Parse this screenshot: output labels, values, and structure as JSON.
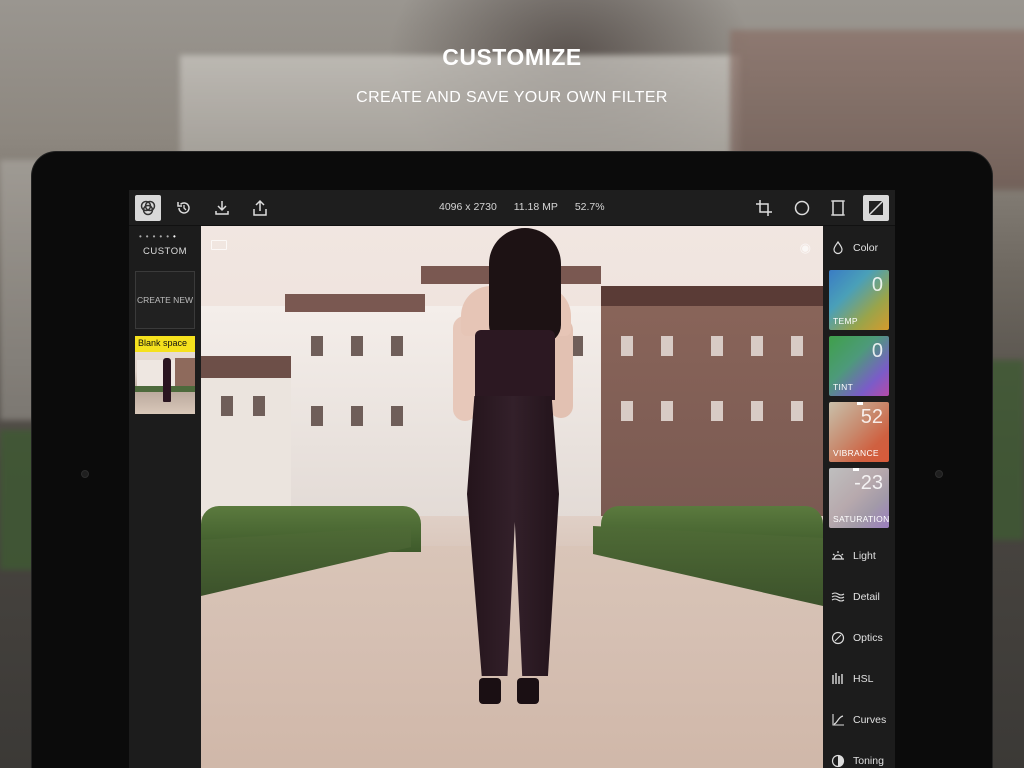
{
  "header": {
    "title": "CUSTOMIZE",
    "subtitle": "CREATE AND SAVE YOUR OWN FILTER"
  },
  "toolbar": {
    "left_icons": [
      "filters-icon",
      "history-icon",
      "download-icon",
      "share-icon"
    ],
    "info": {
      "dimensions": "4096 x 2730",
      "megapixels": "11.18 MP",
      "zoom": "52.7%"
    },
    "right_icons": [
      "crop-icon",
      "vignette-icon",
      "frame-icon",
      "adjust-icon"
    ]
  },
  "left_panel": {
    "label": "CUSTOM",
    "create_new": "CREATE NEW",
    "filters": [
      {
        "name": "Blank space"
      }
    ]
  },
  "right_panel": {
    "color_label": "Color",
    "tiles": [
      {
        "label": "TEMP",
        "value": "0"
      },
      {
        "label": "TINT",
        "value": "0"
      },
      {
        "label": "VIBRANCE",
        "value": "52"
      },
      {
        "label": "SATURATION",
        "value": "-23"
      }
    ],
    "sections": [
      {
        "label": "Light",
        "icon": "sun-icon"
      },
      {
        "label": "Detail",
        "icon": "detail-icon"
      },
      {
        "label": "Optics",
        "icon": "lens-icon"
      },
      {
        "label": "HSL",
        "icon": "hsl-icon"
      },
      {
        "label": "Curves",
        "icon": "curves-icon"
      },
      {
        "label": "Toning",
        "icon": "toning-icon"
      }
    ]
  },
  "colors": {
    "accent_yellow": "#f5e11d",
    "panel_bg": "#1c1c1c"
  }
}
